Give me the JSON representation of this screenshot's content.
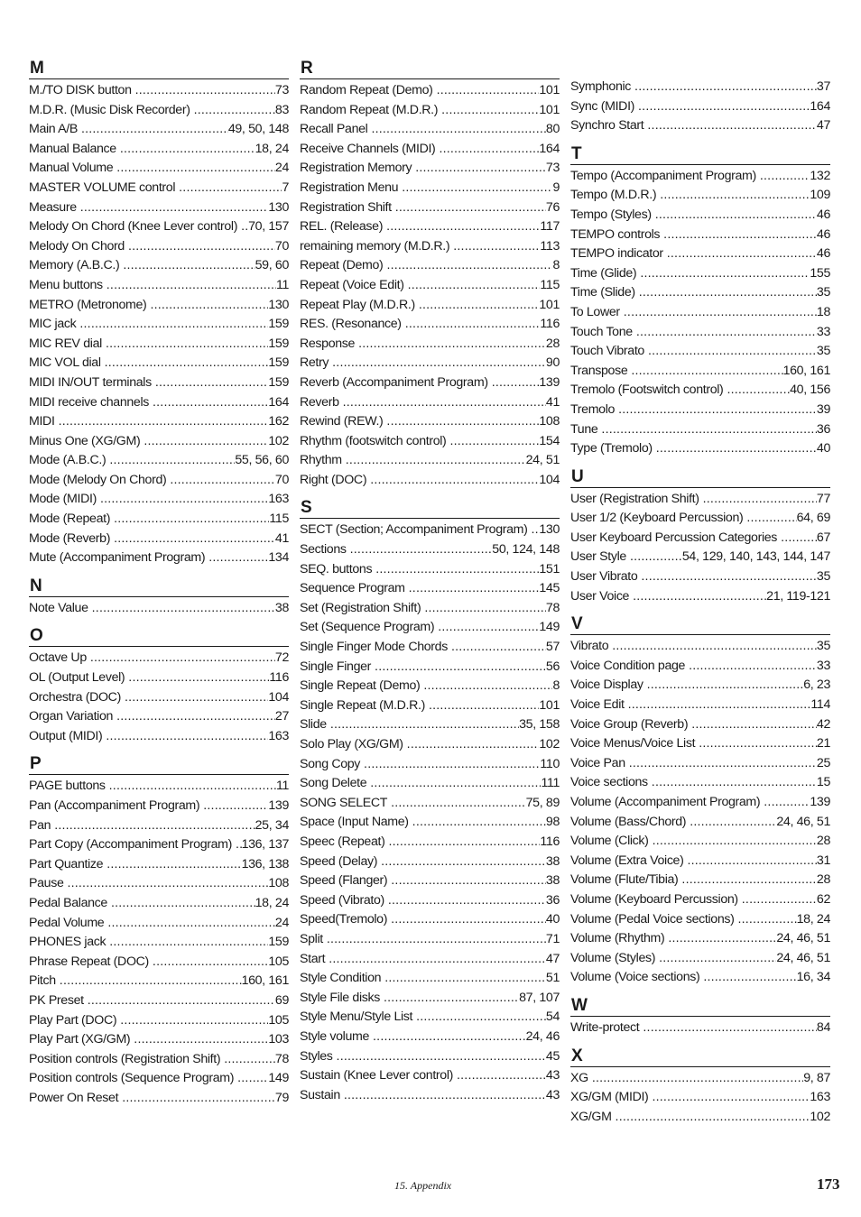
{
  "columns": [
    {
      "sections": [
        {
          "letter": "M",
          "entries": [
            {
              "term": "M./TO DISK button",
              "pages": "73"
            },
            {
              "term": "M.D.R. (Music Disk Recorder)",
              "pages": "83"
            },
            {
              "term": "Main A/B",
              "pages": "49, 50, 148"
            },
            {
              "term": "Manual Balance",
              "pages": "18, 24"
            },
            {
              "term": "Manual Volume",
              "pages": "24"
            },
            {
              "term": "MASTER VOLUME control",
              "pages": "7"
            },
            {
              "term": "Measure",
              "pages": "130"
            },
            {
              "term": "Melody On Chord (Knee Lever control)",
              "pages": "70, 157"
            },
            {
              "term": "Melody On Chord",
              "pages": "70"
            },
            {
              "term": "Memory (A.B.C.)",
              "pages": "59, 60"
            },
            {
              "term": "Menu buttons",
              "pages": "11"
            },
            {
              "term": "METRO (Metronome)",
              "pages": "130"
            },
            {
              "term": "MIC jack",
              "pages": "159"
            },
            {
              "term": "MIC REV dial",
              "pages": "159"
            },
            {
              "term": "MIC VOL dial",
              "pages": "159"
            },
            {
              "term": "MIDI IN/OUT terminals",
              "pages": "159"
            },
            {
              "term": "MIDI receive channels",
              "pages": "164"
            },
            {
              "term": "MIDI",
              "pages": "162"
            },
            {
              "term": "Minus One (XG/GM)",
              "pages": "102"
            },
            {
              "term": "Mode (A.B.C.)",
              "pages": "55, 56, 60"
            },
            {
              "term": "Mode (Melody On Chord)",
              "pages": "70"
            },
            {
              "term": "Mode (MIDI)",
              "pages": "163"
            },
            {
              "term": "Mode (Repeat)",
              "pages": "115"
            },
            {
              "term": "Mode (Reverb)",
              "pages": "41"
            },
            {
              "term": "Mute (Accompaniment Program)",
              "pages": "134"
            }
          ]
        },
        {
          "letter": "N",
          "entries": [
            {
              "term": "Note Value",
              "pages": "38"
            }
          ]
        },
        {
          "letter": "O",
          "entries": [
            {
              "term": "Octave Up",
              "pages": "72"
            },
            {
              "term": "OL (Output Level)",
              "pages": "116"
            },
            {
              "term": "Orchestra (DOC)",
              "pages": "104"
            },
            {
              "term": "Organ Variation",
              "pages": "27"
            },
            {
              "term": "Output (MIDI)",
              "pages": "163"
            }
          ]
        },
        {
          "letter": "P",
          "entries": [
            {
              "term": "PAGE buttons",
              "pages": "11"
            },
            {
              "term": "Pan (Accompaniment Program)",
              "pages": "139"
            },
            {
              "term": "Pan",
              "pages": "25, 34"
            },
            {
              "term": "Part Copy (Accompaniment Program)",
              "pages": "136, 137"
            },
            {
              "term": "Part Quantize",
              "pages": "136, 138"
            },
            {
              "term": "Pause",
              "pages": "108"
            },
            {
              "term": "Pedal Balance",
              "pages": "18, 24"
            },
            {
              "term": "Pedal Volume",
              "pages": "24"
            },
            {
              "term": "PHONES jack",
              "pages": "159"
            },
            {
              "term": "Phrase Repeat (DOC)",
              "pages": "105"
            },
            {
              "term": "Pitch",
              "pages": "160, 161"
            },
            {
              "term": "PK Preset",
              "pages": "69"
            },
            {
              "term": "Play Part (DOC)",
              "pages": "105"
            },
            {
              "term": "Play Part (XG/GM)",
              "pages": "103"
            },
            {
              "term": "Position controls (Registration Shift)",
              "pages": "78"
            },
            {
              "term": "Position controls (Sequence Program)",
              "pages": "149"
            },
            {
              "term": "Power On Reset",
              "pages": "79"
            }
          ]
        }
      ]
    },
    {
      "sections": [
        {
          "letter": "R",
          "entries": [
            {
              "term": "Random Repeat (Demo)",
              "pages": "101"
            },
            {
              "term": "Random Repeat (M.D.R.)",
              "pages": "101"
            },
            {
              "term": "Recall Panel",
              "pages": "80"
            },
            {
              "term": "Receive Channels (MIDI)",
              "pages": "164"
            },
            {
              "term": "Registration Memory",
              "pages": "73"
            },
            {
              "term": "Registration Menu",
              "pages": "9"
            },
            {
              "term": "Registration Shift",
              "pages": "76"
            },
            {
              "term": "REL. (Release)",
              "pages": "117"
            },
            {
              "term": "remaining memory (M.D.R.)",
              "pages": "113"
            },
            {
              "term": "Repeat (Demo)",
              "pages": "8"
            },
            {
              "term": "Repeat (Voice Edit)",
              "pages": "115"
            },
            {
              "term": "Repeat Play (M.D.R.)",
              "pages": "101"
            },
            {
              "term": "RES. (Resonance)",
              "pages": "116"
            },
            {
              "term": "Response",
              "pages": "28"
            },
            {
              "term": "Retry",
              "pages": "90"
            },
            {
              "term": "Reverb (Accompaniment Program)",
              "pages": "139"
            },
            {
              "term": "Reverb",
              "pages": "41"
            },
            {
              "term": "Rewind (REW.)",
              "pages": "108"
            },
            {
              "term": "Rhythm (footswitch control)",
              "pages": "154"
            },
            {
              "term": "Rhythm",
              "pages": "24, 51"
            },
            {
              "term": "Right (DOC)",
              "pages": "104"
            }
          ]
        },
        {
          "letter": "S",
          "entries": [
            {
              "term": "SECT (Section; Accompaniment Program)",
              "pages": "130"
            },
            {
              "term": "Sections",
              "pages": "50, 124, 148"
            },
            {
              "term": "SEQ. buttons",
              "pages": "151"
            },
            {
              "term": "Sequence Program",
              "pages": "145"
            },
            {
              "term": "Set (Registration Shift)",
              "pages": "78"
            },
            {
              "term": "Set (Sequence Program)",
              "pages": "149"
            },
            {
              "term": "Single Finger Mode Chords",
              "pages": "57"
            },
            {
              "term": "Single Finger",
              "pages": "56"
            },
            {
              "term": "Single Repeat (Demo)",
              "pages": "8"
            },
            {
              "term": "Single Repeat (M.D.R.)",
              "pages": "101"
            },
            {
              "term": "Slide",
              "pages": "35, 158"
            },
            {
              "term": "Solo Play (XG/GM)",
              "pages": "102"
            },
            {
              "term": "Song Copy",
              "pages": "110"
            },
            {
              "term": "Song Delete",
              "pages": "111"
            },
            {
              "term": "SONG SELECT",
              "pages": "75, 89"
            },
            {
              "term": "Space (Input Name)",
              "pages": "98"
            },
            {
              "term": "Speec (Repeat)",
              "pages": "116"
            },
            {
              "term": "Speed (Delay)",
              "pages": "38"
            },
            {
              "term": "Speed (Flanger)",
              "pages": "38"
            },
            {
              "term": "Speed (Vibrato)",
              "pages": "36"
            },
            {
              "term": "Speed(Tremolo)",
              "pages": "40"
            },
            {
              "term": "Split",
              "pages": "71"
            },
            {
              "term": "Start",
              "pages": "47"
            },
            {
              "term": "Style Condition",
              "pages": "51"
            },
            {
              "term": "Style File disks",
              "pages": "87, 107"
            },
            {
              "term": "Style Menu/Style List",
              "pages": "54"
            },
            {
              "term": "Style volume",
              "pages": "24, 46"
            },
            {
              "term": "Styles",
              "pages": "45"
            },
            {
              "term": "Sustain (Knee Lever control)",
              "pages": "43"
            },
            {
              "term": "Sustain",
              "pages": "43"
            }
          ]
        }
      ]
    },
    {
      "sections": [
        {
          "letter": "",
          "continued": true,
          "entries": [
            {
              "term": "Symphonic",
              "pages": "37"
            },
            {
              "term": "Sync (MIDI)",
              "pages": "164"
            },
            {
              "term": "Synchro Start",
              "pages": "47"
            }
          ]
        },
        {
          "letter": "T",
          "entries": [
            {
              "term": "Tempo (Accompaniment Program)",
              "pages": "132"
            },
            {
              "term": "Tempo (M.D.R.)",
              "pages": "109"
            },
            {
              "term": "Tempo (Styles)",
              "pages": "46"
            },
            {
              "term": "TEMPO controls",
              "pages": "46"
            },
            {
              "term": "TEMPO indicator",
              "pages": "46"
            },
            {
              "term": "Time (Glide)",
              "pages": "155"
            },
            {
              "term": "Time (Slide)",
              "pages": "35"
            },
            {
              "term": "To Lower",
              "pages": "18"
            },
            {
              "term": "Touch Tone",
              "pages": "33"
            },
            {
              "term": "Touch Vibrato",
              "pages": "35"
            },
            {
              "term": "Transpose",
              "pages": "160, 161"
            },
            {
              "term": "Tremolo (Footswitch control)",
              "pages": "40, 156"
            },
            {
              "term": "Tremolo",
              "pages": "39"
            },
            {
              "term": "Tune",
              "pages": "36"
            },
            {
              "term": "Type (Tremolo)",
              "pages": "40"
            }
          ]
        },
        {
          "letter": "U",
          "entries": [
            {
              "term": "User (Registration Shift)",
              "pages": "77"
            },
            {
              "term": "User 1/2 (Keyboard Percussion)",
              "pages": "64, 69"
            },
            {
              "term": "User Keyboard Percussion Categories",
              "pages": "67"
            },
            {
              "term": "User Style",
              "pages": "54, 129, 140, 143, 144, 147"
            },
            {
              "term": "User Vibrato",
              "pages": "35"
            },
            {
              "term": "User Voice",
              "pages": "21, 119-121"
            }
          ]
        },
        {
          "letter": "V",
          "entries": [
            {
              "term": "Vibrato",
              "pages": "35"
            },
            {
              "term": "Voice Condition page",
              "pages": "33"
            },
            {
              "term": "Voice Display",
              "pages": "6, 23"
            },
            {
              "term": "Voice Edit",
              "pages": "114"
            },
            {
              "term": "Voice Group (Reverb)",
              "pages": "42"
            },
            {
              "term": "Voice Menus/Voice List",
              "pages": "21"
            },
            {
              "term": "Voice Pan",
              "pages": "25"
            },
            {
              "term": "Voice sections",
              "pages": "15"
            },
            {
              "term": "Volume (Accompaniment Program)",
              "pages": "139"
            },
            {
              "term": "Volume (Bass/Chord)",
              "pages": "24, 46, 51"
            },
            {
              "term": "Volume (Click)",
              "pages": "28"
            },
            {
              "term": "Volume (Extra Voice)",
              "pages": "31"
            },
            {
              "term": "Volume (Flute/Tibia)",
              "pages": "28"
            },
            {
              "term": "Volume (Keyboard Percussion)",
              "pages": "62"
            },
            {
              "term": "Volume (Pedal Voice sections)",
              "pages": "18, 24"
            },
            {
              "term": "Volume (Rhythm)",
              "pages": "24, 46, 51"
            },
            {
              "term": "Volume (Styles)",
              "pages": "24, 46, 51"
            },
            {
              "term": "Volume (Voice sections)",
              "pages": "16, 34"
            }
          ]
        },
        {
          "letter": "W",
          "entries": [
            {
              "term": "Write-protect",
              "pages": "84"
            }
          ]
        },
        {
          "letter": "X",
          "entries": [
            {
              "term": "XG",
              "pages": "9, 87"
            },
            {
              "term": "XG/GM (MIDI)",
              "pages": "163"
            },
            {
              "term": "XG/GM",
              "pages": "102"
            }
          ]
        }
      ]
    }
  ],
  "footer": {
    "section": "15. Appendix",
    "page_number": "173"
  }
}
